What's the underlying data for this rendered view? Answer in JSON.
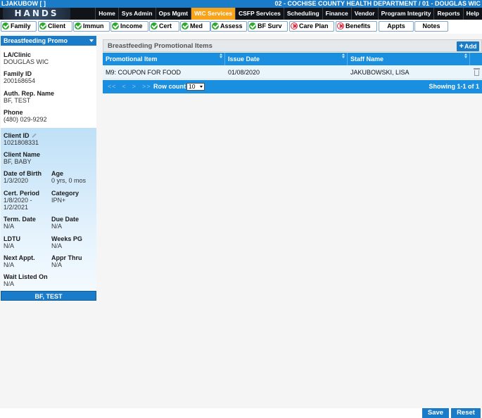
{
  "topbar": {
    "user": "LJAKUBOW",
    "bracket_open": "[",
    "bracket_hidden": "      ",
    "bracket_close": "]",
    "department": "02 - COCHISE COUNTY HEALTH DEPARTMENT / 01 - DOUGLAS WIC"
  },
  "logo": {
    "text": "HANDS"
  },
  "menu": [
    {
      "label": "Home"
    },
    {
      "label": "Sys Admin"
    },
    {
      "label": "Ops Mgmt"
    },
    {
      "label": "WIC Services",
      "active": true
    },
    {
      "label": "CSFP Services"
    },
    {
      "label": "Scheduling"
    },
    {
      "label": "Finance"
    },
    {
      "label": "Vendor"
    },
    {
      "label": "Program Integrity"
    },
    {
      "label": "Reports"
    },
    {
      "label": "Help"
    }
  ],
  "tabs": [
    {
      "label": "Family",
      "status": "ok"
    },
    {
      "label": "Client",
      "status": "ok"
    },
    {
      "label": "Immun",
      "status": "ok"
    },
    {
      "label": "Income",
      "status": "ok"
    },
    {
      "label": "Cert",
      "status": "ok"
    },
    {
      "label": "Med",
      "status": "ok"
    },
    {
      "label": "Assess",
      "status": "ok"
    },
    {
      "label": "BF Surv",
      "status": "ok"
    },
    {
      "label": "Care Plan",
      "status": "error"
    },
    {
      "label": "Benefits",
      "status": "error"
    },
    {
      "label": "Appts",
      "status": "none"
    },
    {
      "label": "Notes",
      "status": "none"
    }
  ],
  "sidebar": {
    "dropdown": "Breastfeeding Promo",
    "la_clinic_label": "LA/Clinic",
    "la_clinic_value": "DOUGLAS WIC",
    "family_id_label": "Family ID",
    "family_id_value": "200168654",
    "auth_rep_label": "Auth. Rep. Name",
    "auth_rep_value": "BF, TEST",
    "phone_label": "Phone",
    "phone_value": "(480) 029-9292",
    "client_id_label": "Client ID",
    "client_id_value": "1021808331",
    "client_name_label": "Client Name",
    "client_name_value": "BF, BABY",
    "dob_label": "Date of Birth",
    "dob_value": "1/3/2020",
    "age_label": "Age",
    "age_value": "0 yrs, 0 mos",
    "cert_period_label": "Cert. Period",
    "cert_period_value_1": "1/8/2020 -",
    "cert_period_value_2": "1/2/2021",
    "category_label": "Category",
    "category_value": "IPN+",
    "term_date_label": "Term. Date",
    "term_date_value": "N/A",
    "due_date_label": "Due Date",
    "due_date_value": "N/A",
    "ldtu_label": "LDTU",
    "ldtu_value": "N/A",
    "weeks_pg_label": "Weeks PG",
    "weeks_pg_value": "N/A",
    "next_appt_label": "Next Appt.",
    "next_appt_value": "N/A",
    "appr_thru_label": "Appr Thru",
    "appr_thru_value": "N/A",
    "wait_listed_label": "Wait Listed On",
    "wait_listed_value": "N/A",
    "footer_name": "BF, TEST"
  },
  "panel": {
    "title": "Breastfeeding Promotional Items",
    "add_label": "Add",
    "columns": [
      "Promotional Item",
      "Issue Date",
      "Staff Name"
    ],
    "rows": [
      {
        "item": "M9: COUPON FOR FOOD",
        "issue_date": "01/08/2020",
        "staff": "JAKUBOWSKI, LISA"
      }
    ],
    "pager_nav": [
      "<<",
      "<",
      ">",
      ">>"
    ],
    "row_count_label": "Row count:",
    "row_count_value": "10",
    "showing": "Showing 1-1 of 1"
  },
  "buttons": {
    "save": "Save",
    "reset": "Reset"
  }
}
